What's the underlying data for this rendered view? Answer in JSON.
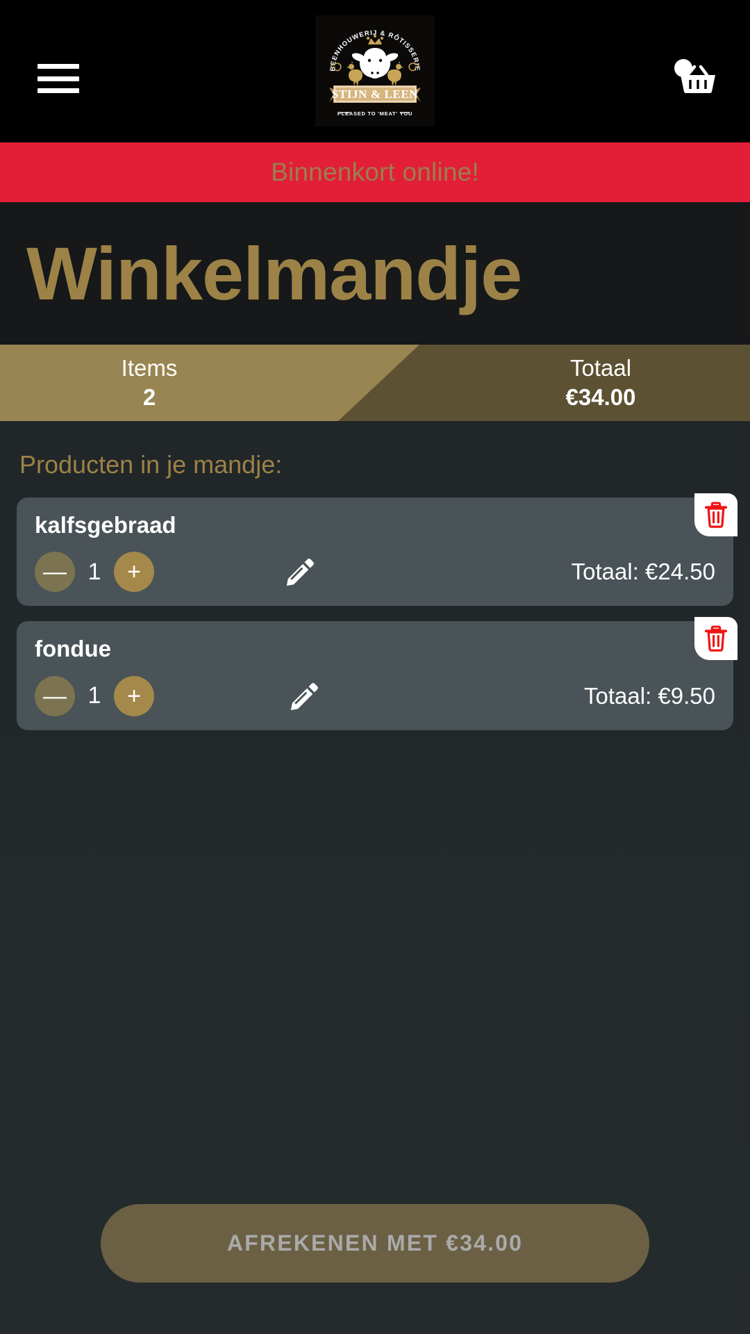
{
  "header": {
    "menu_icon": "hamburger-menu-icon",
    "cart_icon": "shopping-basket-icon",
    "logo": {
      "arc_text": "BEENHOUWERIJ & RÔTISSERIE",
      "banner_text": "STIJN & LEEN",
      "tagline": "PLEASED TO 'MEAT' YOU"
    }
  },
  "announcement": {
    "text": "Binnenkort online!"
  },
  "hero": {
    "title": "Winkelmandje"
  },
  "stats": {
    "items_label": "Items",
    "items_value": "2",
    "total_label": "Totaal",
    "total_value": "€34.00"
  },
  "cart": {
    "section_heading": "Producten in je mandje:",
    "items": [
      {
        "name": "kalfsgebraad",
        "quantity": "1",
        "decrease_label": "—",
        "increase_label": "+",
        "edit_icon": "pencil-icon",
        "delete_icon": "trash-icon",
        "line_total": "Totaal: €24.50"
      },
      {
        "name": "fondue",
        "quantity": "1",
        "decrease_label": "—",
        "increase_label": "+",
        "edit_icon": "pencil-icon",
        "delete_icon": "trash-icon",
        "line_total": "Totaal: €9.50"
      }
    ]
  },
  "checkout": {
    "label": "AFREKENEN MET €34.00"
  },
  "colors": {
    "accent_gold": "#9c8246",
    "accent_gold_light": "#988551",
    "accent_gold_dark": "#5c5132",
    "announce_red": "#e21f37",
    "delete_red": "#f01414",
    "card_bg": "#4a5357",
    "page_bg": "#24292b",
    "topbar_bg": "#000000"
  }
}
